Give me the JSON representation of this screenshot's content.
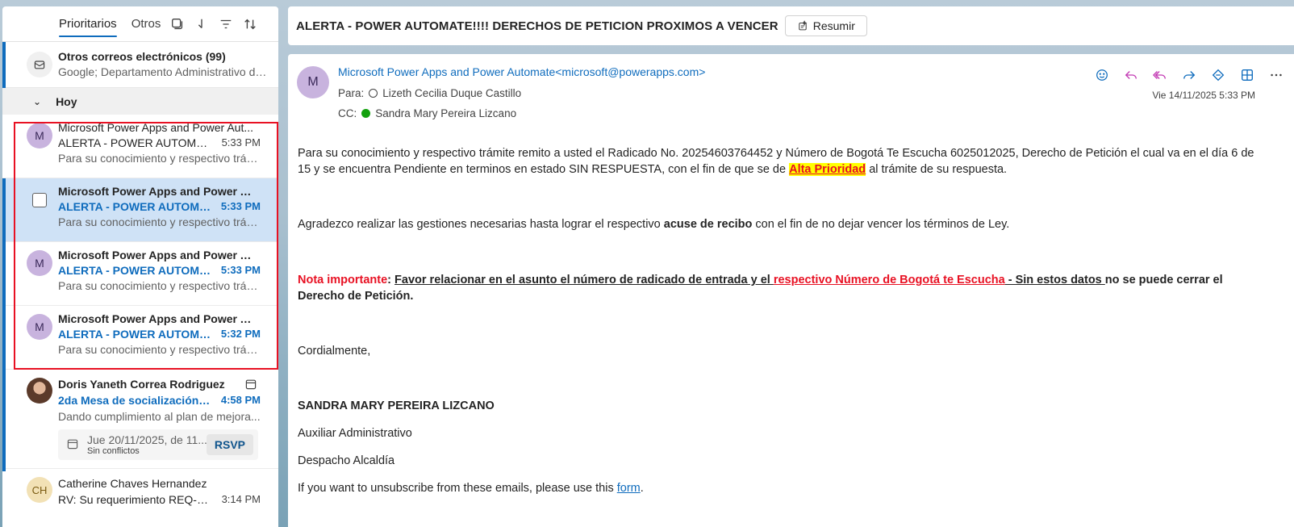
{
  "list": {
    "tabs": {
      "focused": "Prioritarios",
      "other": "Otros"
    },
    "other_mail": {
      "title": "Otros correos electrónicos (99)",
      "preview": "Google; Departamento Administrativo de..."
    },
    "group": {
      "label": "Hoy"
    },
    "messages": [
      {
        "avatar": "M",
        "sender": "Microsoft Power Apps and Power Aut...",
        "subject": "ALERTA - POWER AUTOMATE!...",
        "time": "5:33 PM",
        "preview": "Para su conocimiento y respectivo trám..."
      },
      {
        "avatar": "",
        "sender": "Microsoft Power Apps and Power Au...",
        "subject": "ALERTA - POWER AUTOMAT...",
        "time": "5:33 PM",
        "preview": "Para su conocimiento y respectivo trám..."
      },
      {
        "avatar": "M",
        "sender": "Microsoft Power Apps and Power Au...",
        "subject": "ALERTA - POWER AUTOMAT...",
        "time": "5:33 PM",
        "preview": "Para su conocimiento y respectivo trám..."
      },
      {
        "avatar": "M",
        "sender": "Microsoft Power Apps and Power Au...",
        "subject": "ALERTA - POWER AUTOMAT...",
        "time": "5:32 PM",
        "preview": "Para su conocimiento y respectivo trám..."
      }
    ],
    "doris": {
      "sender": "Doris Yaneth Correa Rodriguez",
      "subject": "2da Mesa de socialización d...",
      "time": "4:58 PM",
      "preview": "Dando cumplimiento al plan de mejora...",
      "cal_date": "Jue 20/11/2025, de 11...",
      "cal_status": "Sin conflictos",
      "rsvp": "RSVP"
    },
    "catherine": {
      "initials": "CH",
      "sender": "Catherine Chaves Hernandez",
      "subject": "RV: Su requerimiento REQ-33...",
      "time": "3:14 PM"
    }
  },
  "reading": {
    "subject": "ALERTA - POWER AUTOMATE!!!!  DERECHOS DE PETICION PROXIMOS A VENCER",
    "summarize_label": "Resumir",
    "avatar": "M",
    "from": "Microsoft Power Apps and Power Automate<microsoft@powerapps.com>",
    "to_label": "Para:",
    "to": "Lizeth Cecilia Duque Castillo",
    "cc_label": "CC:",
    "cc": "Sandra Mary Pereira Lizcano",
    "date": "Vie 14/11/2025 5:33 PM",
    "body": {
      "p1a": "Para su conocimiento y respectivo trámite remito a usted el Radicado No. 20254603764452 y Número de Bogotá Te Escucha 6025012025, Derecho de Petición el cual va en el día 6 de 15 y se encuentra Pendiente en terminos en estado SIN RESPUESTA, con el fin de que se de ",
      "p1_highlight": "Alta Prioridad",
      "p1b": " al trámite de su respuesta.",
      "p2a": "Agradezco realizar las gestiones necesarias hasta lograr el respectivo ",
      "p2_bold": "acuse de recibo",
      "p2b": " con el fin de no dejar vencer los términos de Ley.",
      "note_label": "Nota importante",
      "note_colon": ": ",
      "note_a": "Favor relacionar en el asunto el número de radicado de entrada y el ",
      "note_red": "respectivo Número de Bogotá te Escucha",
      "note_b": " - Sin estos datos ",
      "note_c": "no se puede cerrar el Derecho de Petición.",
      "closing": "Cordialmente,",
      "sig_name": "SANDRA MARY PEREIRA LIZCANO",
      "sig_role": "Auxiliar Administrativo",
      "sig_office": "Despacho Alcaldía",
      "unsub_a": "If you want to unsubscribe from these emails, please use this ",
      "unsub_link": "form",
      "unsub_b": "."
    }
  },
  "colors": {
    "accent": "#0f6cbd",
    "selected_bg": "#cfe2f6",
    "highlight_border": "#e81123",
    "avatar_purple": "#c8b3de"
  }
}
